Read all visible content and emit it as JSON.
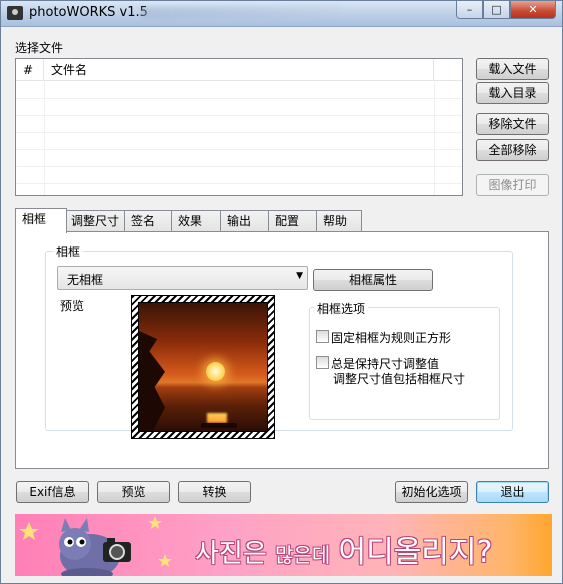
{
  "window": {
    "title": "photoWORKS v1.5",
    "controls": {
      "minimize": "–",
      "maximize": "□",
      "close": "✕"
    }
  },
  "files": {
    "group_label": "选择文件",
    "columns": [
      "#",
      "文件名"
    ],
    "rows": [],
    "buttons": {
      "load_file": "载入文件",
      "load_dir": "载入目录",
      "remove_file": "移除文件",
      "remove_all": "全部移除",
      "print": "图像打印"
    }
  },
  "tabs": [
    {
      "label": "相框",
      "active": true
    },
    {
      "label": "调整尺寸",
      "active": false
    },
    {
      "label": "签名",
      "active": false
    },
    {
      "label": "效果",
      "active": false
    },
    {
      "label": "输出",
      "active": false
    },
    {
      "label": "配置",
      "active": false
    },
    {
      "label": "帮助",
      "active": false
    }
  ],
  "frame_panel": {
    "group_title": "相框",
    "frame_select": {
      "value": "无相框"
    },
    "frame_props_button": "相框属性",
    "preview_label": "预览",
    "options_title": "相框选项",
    "options": [
      {
        "label": "固定相框为规则正方形",
        "checked": false
      },
      {
        "label": "总是保持尺寸调整值",
        "checked": false,
        "sub": "调整尺寸值包括相框尺寸"
      }
    ]
  },
  "bottom_buttons": {
    "exif": "Exif信息",
    "preview": "预览",
    "convert": "转换",
    "reset": "初始化选项",
    "exit": "退出"
  },
  "banner": {
    "text_a": "사진은",
    "text_b": "많은데",
    "text_c": "어디올리지?"
  }
}
